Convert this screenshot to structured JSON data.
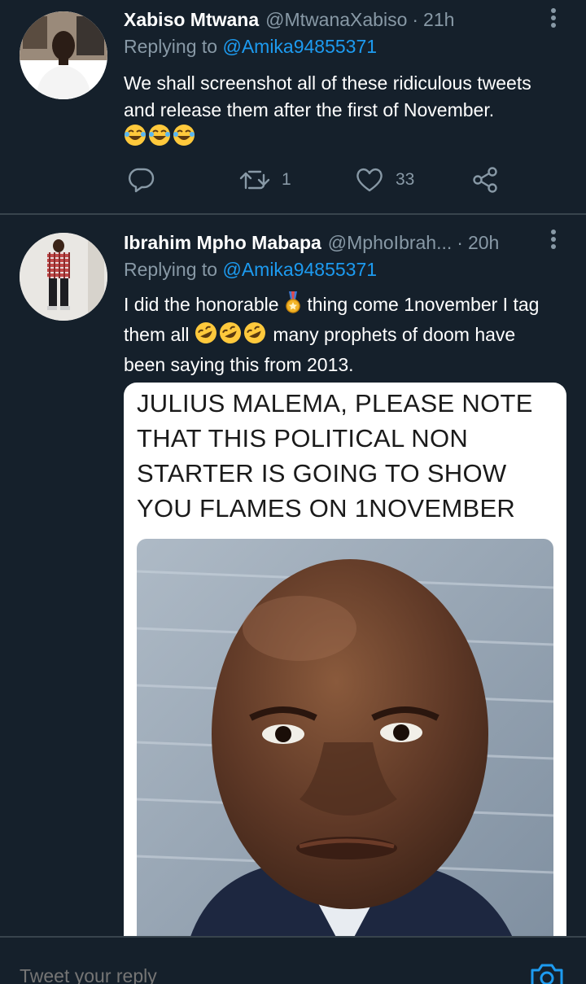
{
  "tweets": [
    {
      "name": "Xabiso Mtwana",
      "handle": "@MtwanaXabiso",
      "time": "21h",
      "replying_label": "Replying to",
      "replying_to": "@Amika94855371",
      "text": "We shall screenshot all of these ridiculous tweets and release them after the first of November.",
      "emojis": [
        "😂",
        "😂",
        "😂"
      ],
      "retweets": "1",
      "likes": "33"
    },
    {
      "name": "Ibrahim Mpho Mabapa",
      "handle": "@MphoIbrah...",
      "time": "20h",
      "replying_label": "Replying to",
      "replying_to": "@Amika94855371",
      "text_part1": "I did the honorable",
      "emoji_medal": "🎖",
      "text_part2": "thing come 1november I tag them all",
      "emojis": [
        "🤣",
        "🤣",
        "🤣"
      ],
      "text_part3": "many prophets of doom have been saying this from 2013.",
      "media_caption": "JULIUS MALEMA, PLEASE NOTE THAT THIS POLITICAL NON STARTER IS GOING TO SHOW YOU FLAMES ON  1NOVEMBER"
    }
  ],
  "reply_bar": {
    "placeholder": "Tweet your reply"
  },
  "icons": {
    "reply": "reply-icon",
    "retweet": "retweet-icon",
    "like": "heart-icon",
    "share": "share-icon",
    "more": "more-vertical-icon",
    "camera": "camera-icon"
  },
  "colors": {
    "background": "#15202b",
    "divider": "#38444d",
    "secondary_text": "#8899a6",
    "link": "#1d9bf0"
  }
}
